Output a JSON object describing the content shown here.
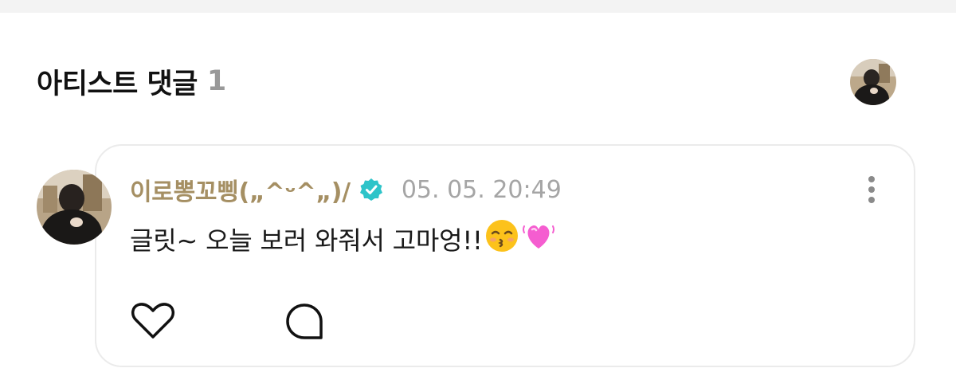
{
  "section": {
    "title": "아티스트 댓글",
    "count": "1"
  },
  "comment": {
    "author": "이로뽕꼬삥(„^ᵕ^„)/",
    "date": "05. 05. 20:49",
    "text": "글릿~ 오늘 보러 와줘서 고마엉!!",
    "emojis": [
      "kissing-face-with-closed-eyes",
      "growing-heart"
    ]
  },
  "icons": {
    "verified": "verified-badge-icon",
    "more": "more-vertical-icon",
    "like": "heart-outline-icon",
    "reply": "comment-bubble-icon"
  },
  "colors": {
    "author": "#a58f63",
    "verified": "#2ec4c9",
    "date": "#a5a5a5",
    "count": "#999999",
    "card_border": "#ebebeb"
  }
}
